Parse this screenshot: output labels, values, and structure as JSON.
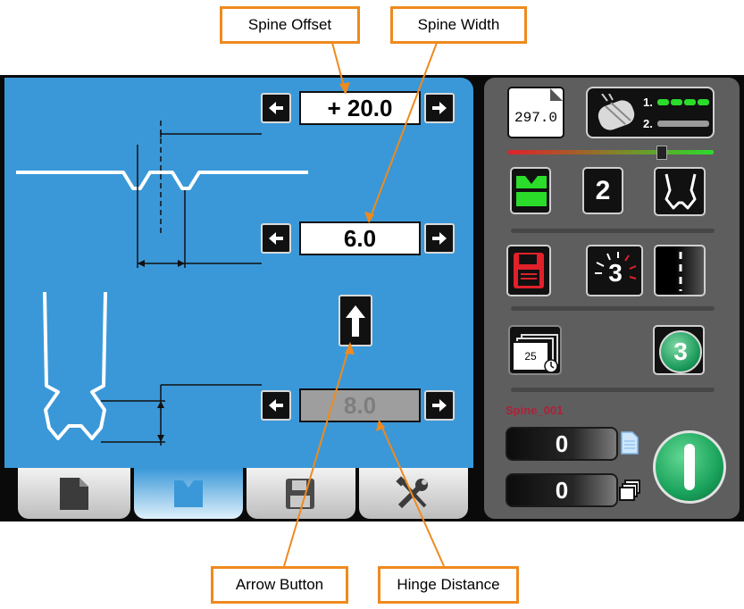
{
  "callouts": {
    "spine_offset": "Spine Offset",
    "spine_width": "Spine Width",
    "arrow_button": "Arrow Button",
    "hinge_distance": "Hinge Distance"
  },
  "fields": {
    "spine_offset": "+ 20.0",
    "spine_width": "6.0",
    "hinge_distance": "8.0"
  },
  "right_panel": {
    "sheet_length": "297.0",
    "bend_count": "2",
    "sequence_step": "3",
    "stack_count": "25",
    "program_badge": "3",
    "roll_labels": [
      "1.",
      "2."
    ],
    "program_name": "Spine_001",
    "counter_pieces": "0",
    "counter_stacks": "0"
  },
  "tabs": [
    "document",
    "tooling",
    "save",
    "settings"
  ],
  "colors": {
    "accent_orange": "#ef8a1e",
    "panel_blue": "#3a98d8",
    "ok_green": "#2bdc2b",
    "save_red": "#e1202a",
    "program_name_red": "#b0203a"
  }
}
